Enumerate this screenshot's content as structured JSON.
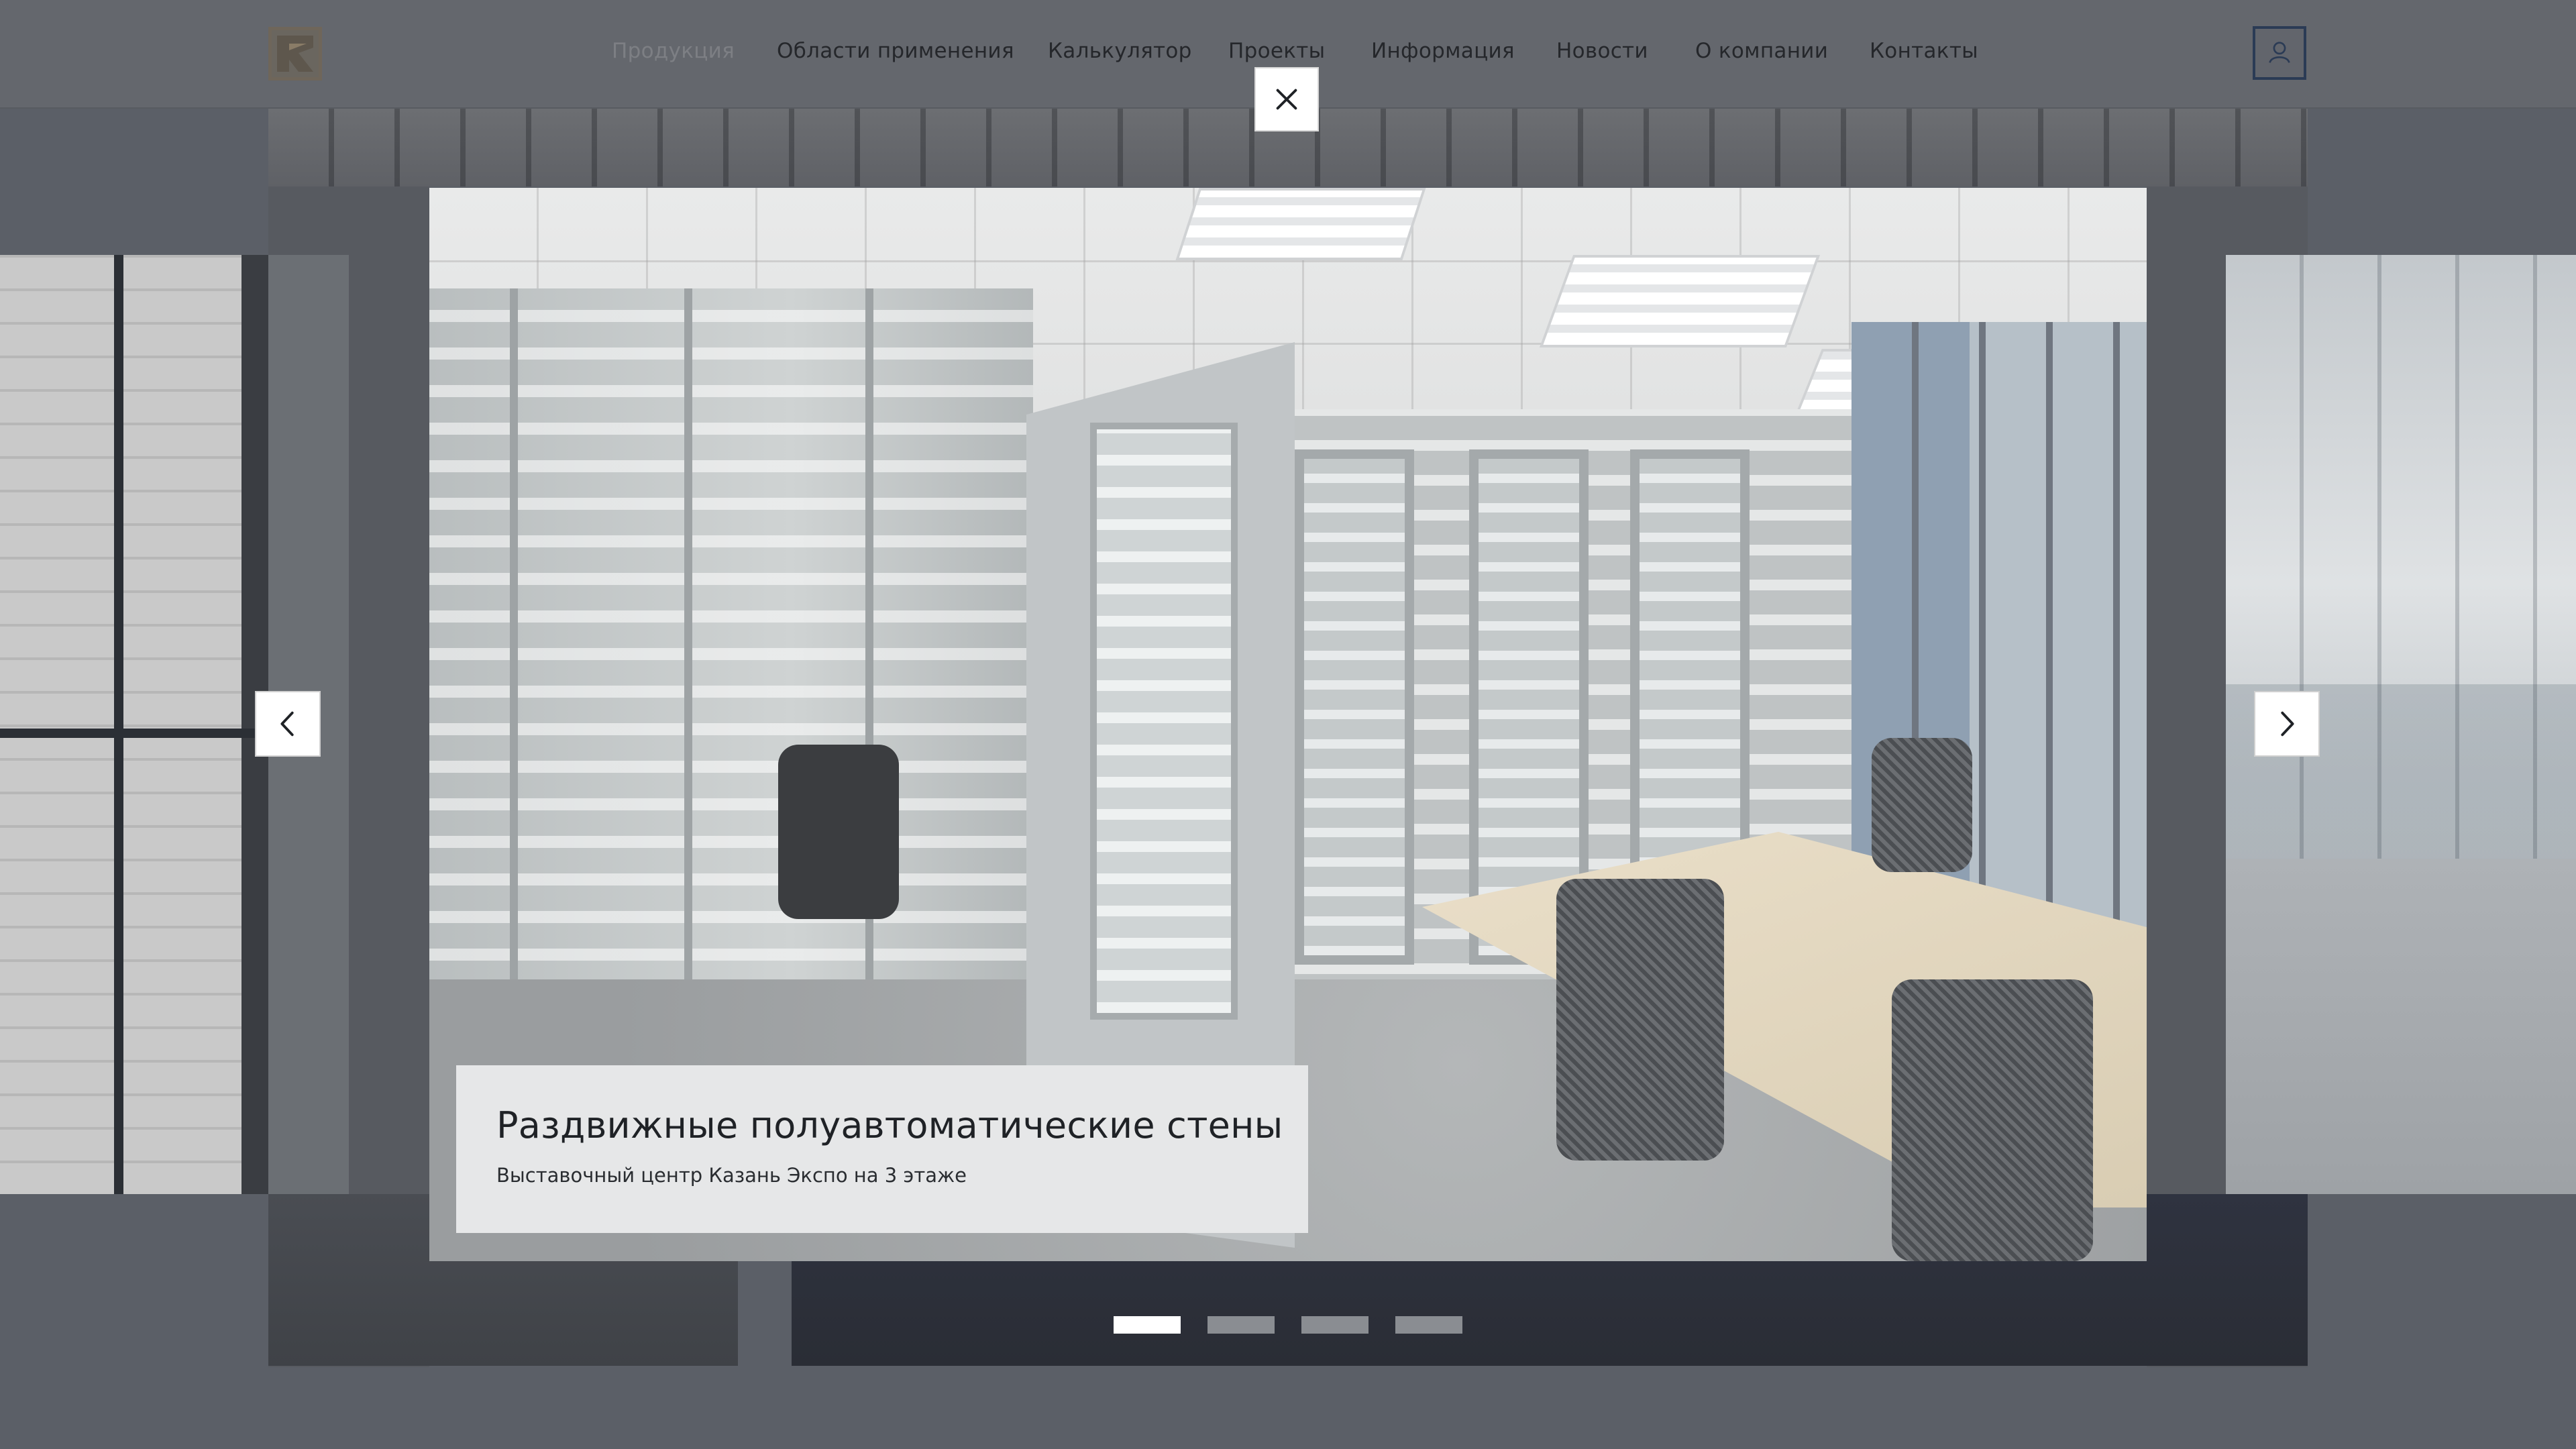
{
  "header": {
    "logo_icon": "brand-logo-icon",
    "nav": [
      {
        "label": "Продукция",
        "active": true
      },
      {
        "label": "Области применения",
        "active": false
      },
      {
        "label": "Калькулятор",
        "active": false
      },
      {
        "label": "Проекты",
        "active": false
      },
      {
        "label": "Информация",
        "active": false
      },
      {
        "label": "Новости",
        "active": false
      },
      {
        "label": "О компании",
        "active": false
      },
      {
        "label": "Контакты",
        "active": false
      }
    ],
    "user_icon": "user-icon"
  },
  "lightbox": {
    "close_icon": "close-icon",
    "prev_icon": "chevron-left-icon",
    "next_icon": "chevron-right-icon",
    "caption": {
      "title": "Раздвижные полуавтоматические стены",
      "subtitle": "Выставочный центр Казань Экспо на 3 этаже"
    },
    "slides_total": 4,
    "current_slide": 1
  },
  "colors": {
    "overlay": "#5b5f67",
    "active_dot": "#ffffff",
    "inactive_dot": "#8a8d92",
    "user_border": "#2b3b55"
  }
}
